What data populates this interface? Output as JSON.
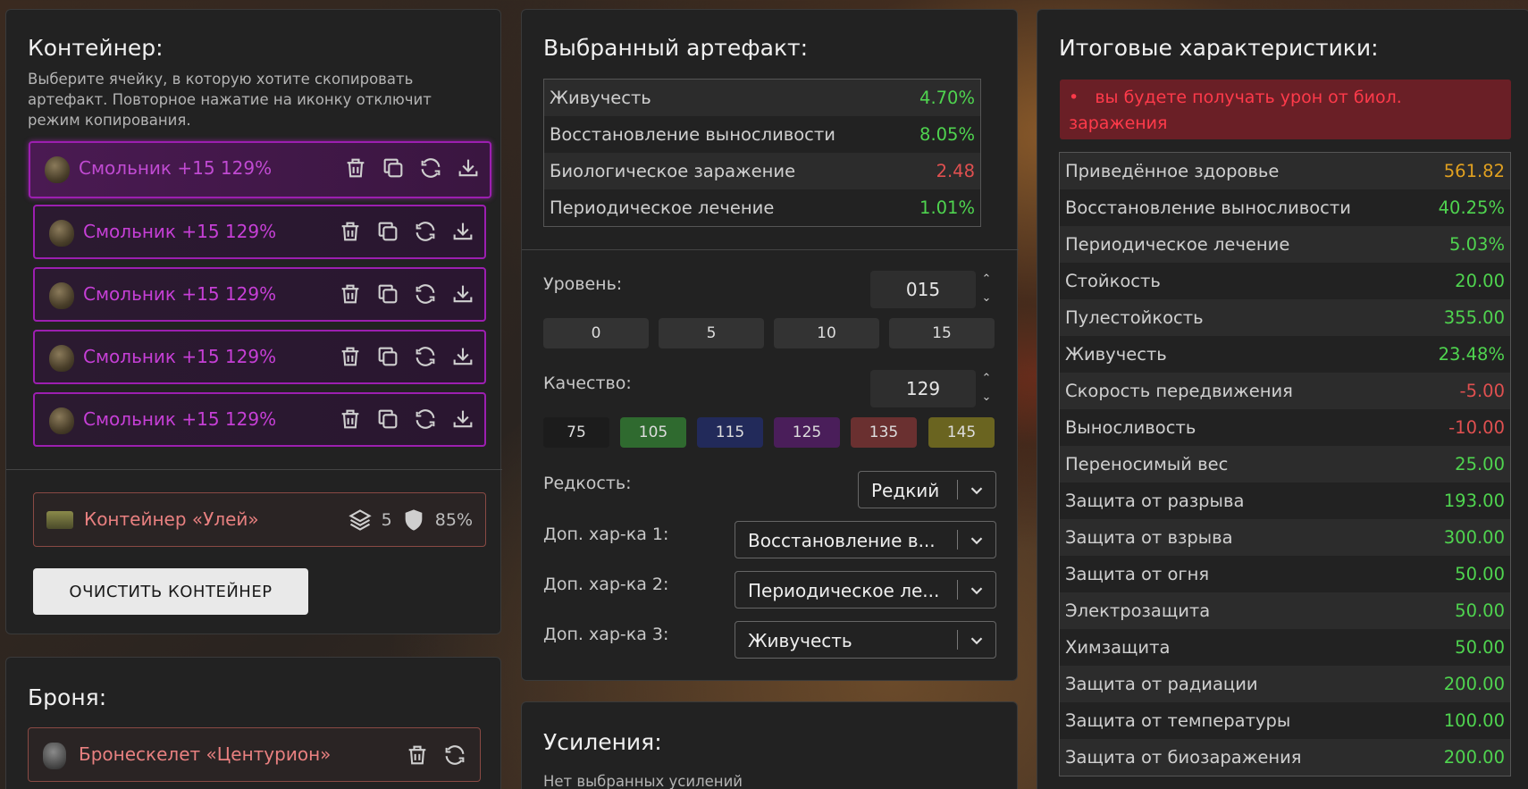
{
  "container_panel": {
    "title": "Контейнер:",
    "hint": "Выберите ячейку, в которую хотите скопировать артефакт. Повторное нажатие на иконку отключит режим копирования.",
    "slots": [
      {
        "label": "Смольник +15 129%"
      },
      {
        "label": "Смольник +15 129%"
      },
      {
        "label": "Смольник +15 129%"
      },
      {
        "label": "Смольник +15 129%"
      },
      {
        "label": "Смольник +15 129%"
      }
    ],
    "container": {
      "name": "Контейнер «Улей»",
      "capacity": "5",
      "protection": "85%"
    },
    "clear_button": "ОЧИСТИТЬ КОНТЕЙНЕР"
  },
  "armor_panel": {
    "title": "Броня:",
    "armor_name": "Бронескелет «Центурион»"
  },
  "artifact_panel": {
    "title": "Выбранный артефакт:",
    "stats": [
      {
        "name": "Живучесть",
        "value": "4.70%",
        "color": "#4fd44f"
      },
      {
        "name": "Восстановление выносливости",
        "value": "8.05%",
        "color": "#4fd44f"
      },
      {
        "name": "Биологическое заражение",
        "value": "2.48",
        "color": "#e05050"
      },
      {
        "name": "Периодическое лечение",
        "value": "1.01%",
        "color": "#4fd44f"
      }
    ],
    "level_label": "Уровень:",
    "level_value": "015",
    "level_presets": [
      "0",
      "5",
      "10",
      "15"
    ],
    "quality_label": "Качество:",
    "quality_value": "129",
    "quality_presets": [
      {
        "label": "75",
        "color": "#1c1c1c"
      },
      {
        "label": "105",
        "color": "#2f6a2f"
      },
      {
        "label": "115",
        "color": "#222a5a"
      },
      {
        "label": "125",
        "color": "#4a1e5a"
      },
      {
        "label": "135",
        "color": "#6a3030"
      },
      {
        "label": "145",
        "color": "#6a6420"
      }
    ],
    "rarity_label": "Редкость:",
    "rarity_value": "Редкий",
    "extra1_label": "Доп. хар-ка 1:",
    "extra1_value": "Восстановление в...",
    "extra2_label": "Доп. хар-ка 2:",
    "extra2_value": "Периодическое ле...",
    "extra3_label": "Доп. хар-ка 3:",
    "extra3_value": "Живучесть"
  },
  "boosts_panel": {
    "title": "Усиления:",
    "empty_text": "Нет выбранных усилений"
  },
  "totals_panel": {
    "title": "Итоговые характеристики:",
    "warning": "вы будете получать урон от биол. заражения",
    "stats": [
      {
        "name": "Приведённое здоровье",
        "value": "561.82",
        "color": "#e0a020"
      },
      {
        "name": "Восстановление выносливости",
        "value": "40.25%",
        "color": "#4fd44f"
      },
      {
        "name": "Периодическое лечение",
        "value": "5.03%",
        "color": "#4fd44f"
      },
      {
        "name": "Стойкость",
        "value": "20.00",
        "color": "#4fd44f"
      },
      {
        "name": "Пулестойкость",
        "value": "355.00",
        "color": "#4fd44f"
      },
      {
        "name": "Живучесть",
        "value": "23.48%",
        "color": "#4fd44f"
      },
      {
        "name": "Скорость передвижения",
        "value": "-5.00",
        "color": "#e05050"
      },
      {
        "name": "Выносливость",
        "value": "-10.00",
        "color": "#e05050"
      },
      {
        "name": "Переносимый вес",
        "value": "25.00",
        "color": "#4fd44f"
      },
      {
        "name": "Защита от разрыва",
        "value": "193.00",
        "color": "#4fd44f"
      },
      {
        "name": "Защита от взрыва",
        "value": "300.00",
        "color": "#4fd44f"
      },
      {
        "name": "Защита от огня",
        "value": "50.00",
        "color": "#4fd44f"
      },
      {
        "name": "Электрозащита",
        "value": "50.00",
        "color": "#4fd44f"
      },
      {
        "name": "Химзащита",
        "value": "50.00",
        "color": "#4fd44f"
      },
      {
        "name": "Защита от радиации",
        "value": "200.00",
        "color": "#4fd44f"
      },
      {
        "name": "Защита от температуры",
        "value": "100.00",
        "color": "#4fd44f"
      },
      {
        "name": "Защита от биозаражения",
        "value": "200.00",
        "color": "#4fd44f"
      }
    ]
  }
}
